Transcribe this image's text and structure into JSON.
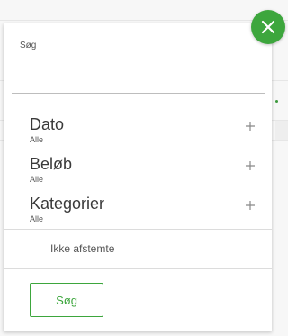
{
  "search": {
    "label": "Søg",
    "value": "",
    "placeholder": ""
  },
  "filters": [
    {
      "title": "Dato",
      "value": "Alle"
    },
    {
      "title": "Beløb",
      "value": "Alle"
    },
    {
      "title": "Kategorier",
      "value": "Alle"
    }
  ],
  "options": {
    "unreconciled_label": "Ikke afstemte"
  },
  "actions": {
    "submit_label": "Søg"
  },
  "colors": {
    "accent": "#3da63d",
    "panel": "#ffffff",
    "divider": "#dcdcdc",
    "text": "#3a3a3a"
  },
  "icons": {
    "close": "close-icon",
    "expand": "plus-icon"
  }
}
